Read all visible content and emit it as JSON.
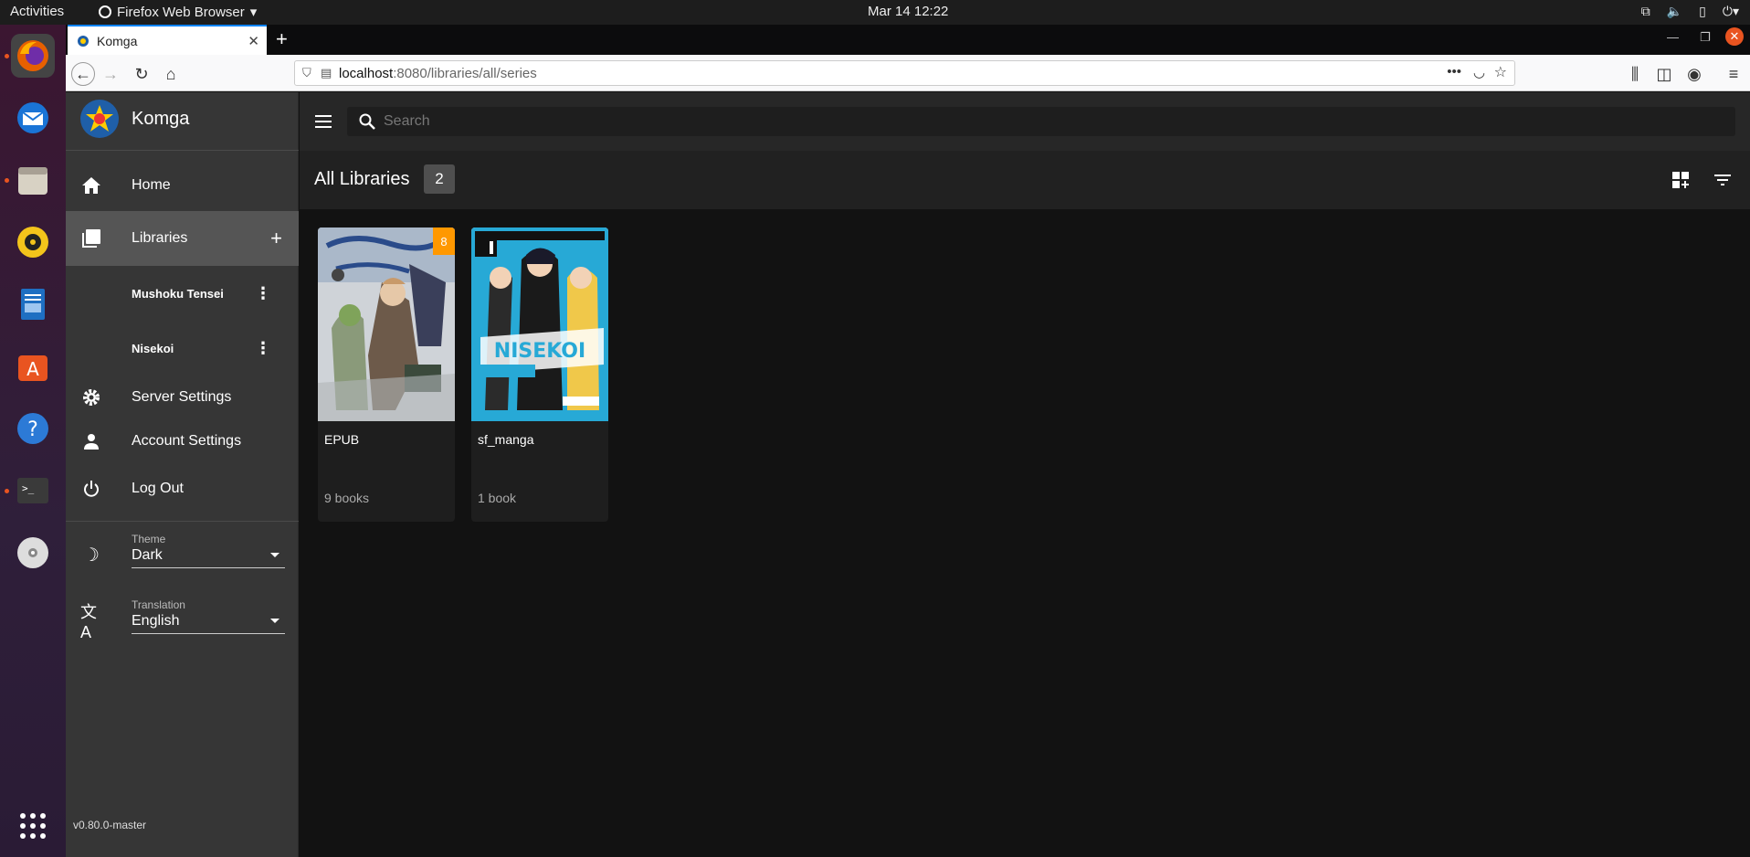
{
  "os": {
    "activities": "Activities",
    "active_app": "Firefox Web Browser",
    "clock": "Mar 14  12:22"
  },
  "browser": {
    "tab_title": "Komga",
    "url_host": "localhost",
    "url_path": ":8080/libraries/all/series"
  },
  "app": {
    "name": "Komga",
    "nav": {
      "home": "Home",
      "libraries": "Libraries",
      "server_settings": "Server Settings",
      "account_settings": "Account Settings",
      "logout": "Log Out"
    },
    "libraries": [
      {
        "name": "Mushoku Tensei"
      },
      {
        "name": "Nisekoi"
      }
    ],
    "theme": {
      "caption": "Theme",
      "value": "Dark"
    },
    "translation": {
      "caption": "Translation",
      "value": "English"
    },
    "version": "v0.80.0-master",
    "search_placeholder": "Search"
  },
  "toolbar": {
    "title": "All Libraries",
    "count": "2"
  },
  "series": [
    {
      "title": "EPUB",
      "books": "9 books",
      "badge": "8"
    },
    {
      "title": "sf_manga",
      "books": "1 book"
    }
  ],
  "colors": {
    "accent_badge": "#ff9800",
    "sidebar_bg": "#363636",
    "content_bg": "#121212"
  }
}
